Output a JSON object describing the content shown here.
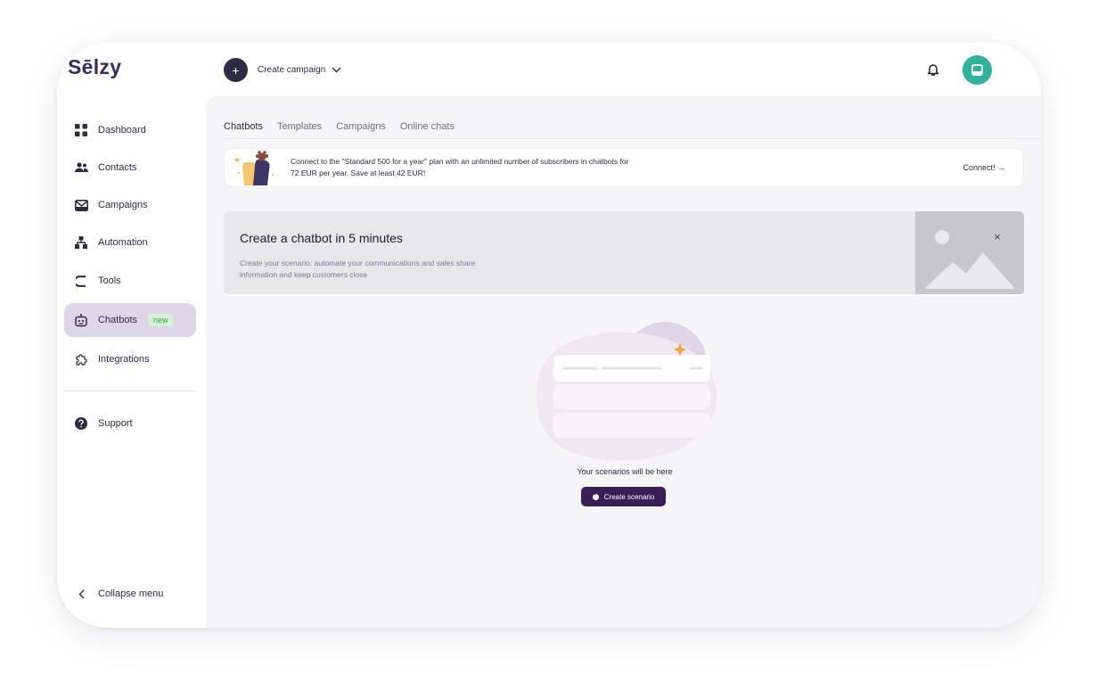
{
  "brand": {
    "logo_text": "Sēlzy"
  },
  "header": {
    "create_campaign_label": "Create campaign",
    "plus_glyph": "+"
  },
  "sidebar": {
    "items": [
      {
        "label": "Dashboard",
        "icon": "dashboard-icon"
      },
      {
        "label": "Contacts",
        "icon": "contacts-icon"
      },
      {
        "label": "Campaigns",
        "icon": "campaigns-icon"
      },
      {
        "label": "Automation",
        "icon": "automation-icon"
      },
      {
        "label": "Tools",
        "icon": "tools-icon"
      },
      {
        "label": "Chatbots",
        "icon": "chatbot-icon",
        "badge": "new",
        "active": true
      },
      {
        "label": "Integrations",
        "icon": "integrations-icon"
      }
    ],
    "support_label": "Support",
    "collapse_label": "Collapse menu"
  },
  "tabs": [
    "Chatbots",
    "Templates",
    "Campaigns",
    "Online chats"
  ],
  "promo": {
    "text": "Connect to the \"Standard 500 for a year\" plan with an unlimited number of subscribers in chatbots for 72 EUR per year. Save at least 42 EUR!",
    "link_label": "Connect! →"
  },
  "banner": {
    "title": "Create a chatbot in 5 minutes",
    "description": "Create your scenario: automate your communications and sales share information and keep customers close",
    "close_glyph": "×"
  },
  "empty_state": {
    "text": "Your scenarios will be here",
    "button_label": "Create scenario"
  },
  "colors": {
    "brand": "#3b2a6a",
    "button": "#3b1d57",
    "avatar": "#2db39e",
    "active_nav": "#ddd6ea",
    "badge_bg": "#d4f2d6",
    "badge_text": "#41a04b"
  }
}
